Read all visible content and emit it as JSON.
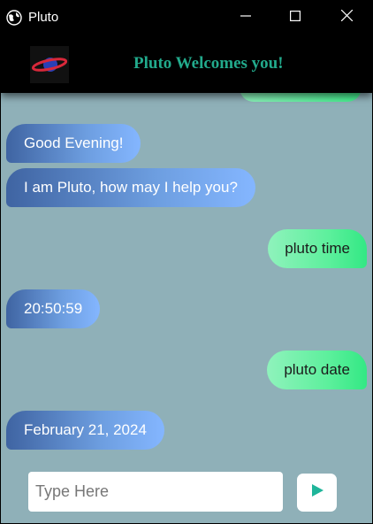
{
  "window": {
    "title": "Pluto"
  },
  "header": {
    "title": "Pluto Welcomes you!"
  },
  "messages": [
    {
      "sender": "bot",
      "text": "Good Evening!"
    },
    {
      "sender": "bot",
      "text": "I am Pluto, how may I help you?"
    },
    {
      "sender": "user",
      "text": "pluto time"
    },
    {
      "sender": "bot",
      "text": "20:50:59"
    },
    {
      "sender": "user",
      "text": "pluto date"
    },
    {
      "sender": "bot",
      "text": "February 21, 2024"
    }
  ],
  "input": {
    "placeholder": "Type Here",
    "value": ""
  },
  "colors": {
    "chat_bg": "#8fb0b8",
    "bot_bubble": "#5b86c8",
    "user_bubble": "#5ef09d",
    "send_icon": "#1fb59a",
    "header_title": "#22aa8c"
  },
  "icons": {
    "app": "globe-icon",
    "minimize": "minimize-icon",
    "maximize": "maximize-icon",
    "close": "close-icon",
    "send": "send-icon"
  }
}
